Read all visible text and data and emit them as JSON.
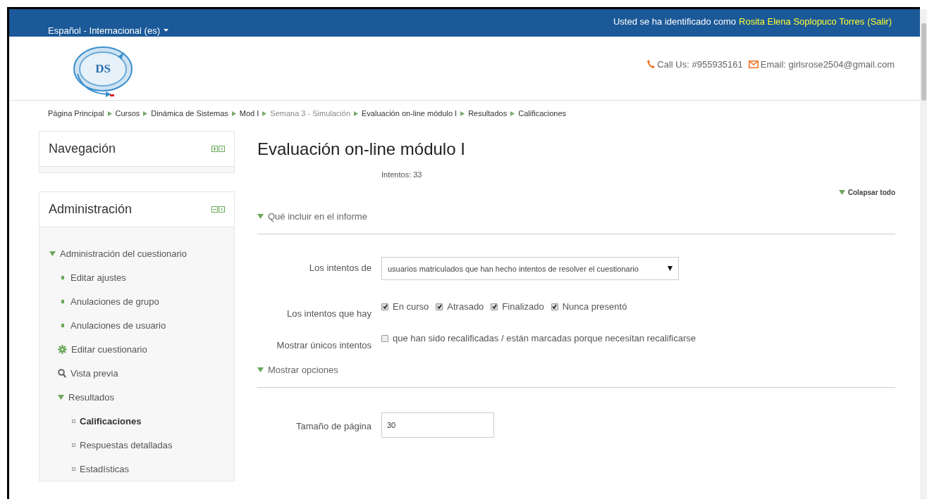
{
  "language_menu": "Español - Internacional (es)",
  "login": {
    "prefix": "Usted se ha identificado como",
    "user": "Rosita Elena Soplopuco Torres",
    "logout": "(Salir)"
  },
  "logo": {
    "text": "DS"
  },
  "contact": {
    "phone": "Call Us: #955935161",
    "email": "Email: girlsrose2504@gmail.com"
  },
  "breadcrumb": [
    {
      "label": "Página Principal",
      "muted": false
    },
    {
      "label": "Cursos",
      "muted": false
    },
    {
      "label": "Dinámica de Sistemas",
      "muted": false
    },
    {
      "label": "Mod I",
      "muted": false
    },
    {
      "label": "Semana 3 - Simulación",
      "muted": true
    },
    {
      "label": "Evaluación on-line módulo I",
      "muted": false
    },
    {
      "label": "Resultados",
      "muted": false
    },
    {
      "label": "Calificaciones",
      "muted": false
    }
  ],
  "blocks": [
    {
      "title": "Navegación",
      "expanded": false
    },
    {
      "title": "Administración",
      "expanded": true,
      "tree": [
        {
          "label": "Administración del cuestionario",
          "kind": "folder",
          "expanded": true,
          "selected": false,
          "children": [
            {
              "label": "Editar ajustes",
              "kind": "leaf",
              "selected": false
            },
            {
              "label": "Anulaciones de grupo",
              "kind": "leaf",
              "selected": false
            },
            {
              "label": "Anulaciones de usuario",
              "kind": "leaf",
              "selected": false
            },
            {
              "label": "Editar cuestionario",
              "kind": "gear",
              "selected": false
            },
            {
              "label": "Vista previa",
              "kind": "search",
              "selected": false
            },
            {
              "label": "Resultados",
              "kind": "folder",
              "expanded": true,
              "selected": false,
              "children": [
                {
                  "label": "Calificaciones",
                  "kind": "subleaf",
                  "selected": true
                },
                {
                  "label": "Respuestas detalladas",
                  "kind": "subleaf",
                  "selected": false
                },
                {
                  "label": "Estadísticas",
                  "kind": "subleaf",
                  "selected": false
                }
              ]
            }
          ]
        }
      ]
    }
  ],
  "main": {
    "title": "Evaluación on-line módulo I",
    "attempts": "Intentos: 33",
    "collapse_all": "Colapsar todo",
    "sections": [
      {
        "title": "Qué incluir en el informe",
        "expanded": true,
        "fields": [
          {
            "kind": "select",
            "label": "Los intentos de",
            "value": "usuarios matriculados que han hecho intentos de resolver el cuestionario"
          },
          {
            "kind": "checkboxes",
            "label": "Los intentos que hay",
            "options": [
              {
                "label": "En curso",
                "checked": true
              },
              {
                "label": "Atrasado",
                "checked": true
              },
              {
                "label": "Finalizado",
                "checked": true
              },
              {
                "label": "Nunca presentó",
                "checked": true
              }
            ]
          },
          {
            "kind": "checkboxes",
            "label": "Mostrar únicos intentos",
            "options": [
              {
                "label": "que han sido recalificadas / están marcadas porque necesitan recalificarse",
                "checked": false
              }
            ]
          }
        ]
      },
      {
        "title": "Mostrar opciones",
        "expanded": true,
        "fields": [
          {
            "kind": "text",
            "label": "Tamaño de página",
            "value": "30"
          }
        ]
      }
    ]
  }
}
